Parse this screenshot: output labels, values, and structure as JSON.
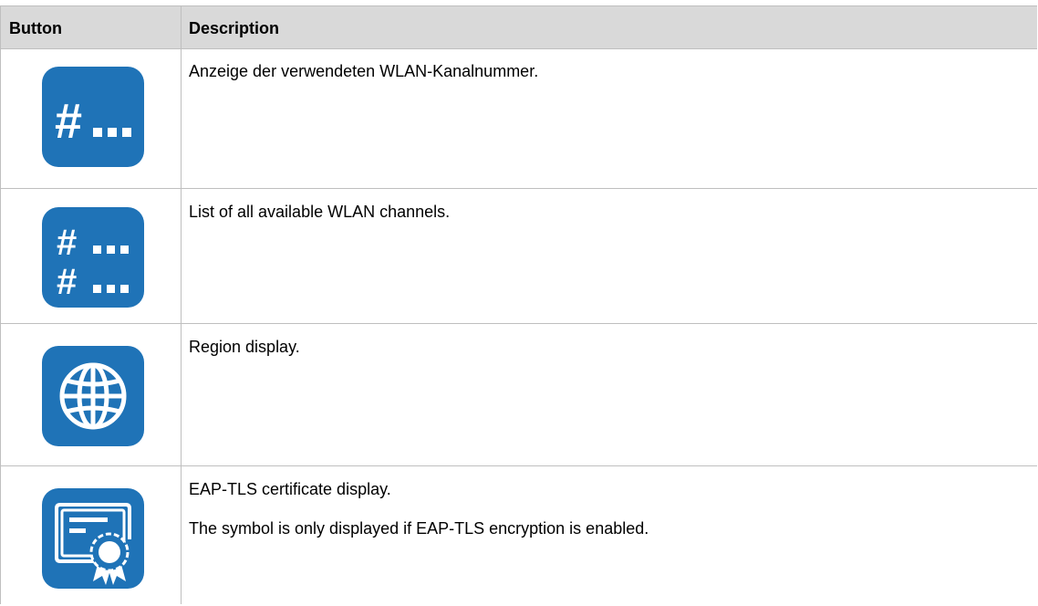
{
  "table": {
    "headers": {
      "button": "Button",
      "description": "Description"
    },
    "rows": [
      {
        "icon": "channel-number-icon",
        "text": "Anzeige der verwendeten WLAN-Kanalnummer."
      },
      {
        "icon": "channel-list-icon",
        "text": "List of all available WLAN channels."
      },
      {
        "icon": "globe-icon",
        "text": "Region display."
      },
      {
        "icon": "certificate-icon",
        "text": "EAP-TLS certificate display.",
        "note": "The symbol is only displayed if EAP-TLS encryption is enabled."
      }
    ]
  },
  "colors": {
    "icon_bg": "#1f73b7",
    "header_bg": "#d9d9d9",
    "grid": "#bfbfbf"
  }
}
